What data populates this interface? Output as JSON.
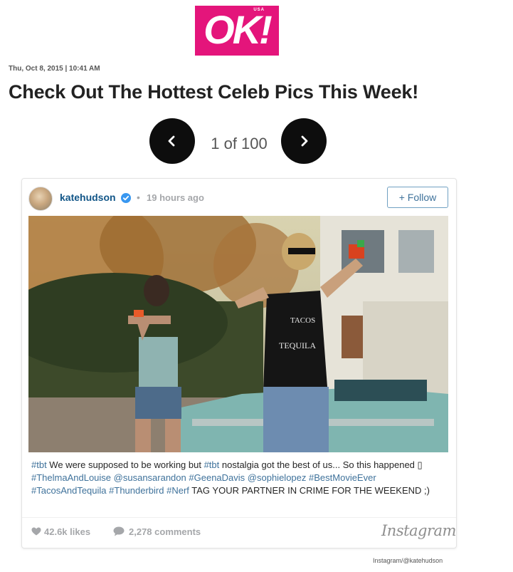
{
  "logo": {
    "text": "OK!",
    "edition": "USA"
  },
  "article": {
    "dateline": "Thu, Oct 8, 2015 | 10:41 AM",
    "title": "Check Out The Hottest Celeb Pics This Week!"
  },
  "gallery": {
    "counter": "1 of 100",
    "prev_icon": "chevron-left-icon",
    "next_icon": "chevron-right-icon"
  },
  "post": {
    "username": "katehudson",
    "time_ago": "19 hours ago",
    "follow_label": "+ Follow",
    "caption": [
      {
        "text": "#tbt",
        "tag": true
      },
      {
        "text": " We were supposed to be working but ",
        "tag": false
      },
      {
        "text": "#tbt",
        "tag": true
      },
      {
        "text": " nostalgia got the best of us... So this happened ",
        "tag": false
      },
      {
        "text": "▯",
        "tag": false
      },
      {
        "text": " ",
        "tag": false
      },
      {
        "text": "#ThelmaAndLouise",
        "tag": true
      },
      {
        "text": " ",
        "tag": false
      },
      {
        "text": "@susansarandon",
        "tag": true
      },
      {
        "text": " ",
        "tag": false
      },
      {
        "text": "#GeenaDavis",
        "tag": true
      },
      {
        "text": " ",
        "tag": false
      },
      {
        "text": "@sophielopez",
        "tag": true
      },
      {
        "text": " ",
        "tag": false
      },
      {
        "text": "#BestMovieEver",
        "tag": true
      },
      {
        "text": " ",
        "tag": false
      },
      {
        "text": "#TacosAndTequila",
        "tag": true
      },
      {
        "text": " ",
        "tag": false
      },
      {
        "text": "#Thunderbird",
        "tag": true
      },
      {
        "text": " ",
        "tag": false
      },
      {
        "text": "#Nerf",
        "tag": true
      },
      {
        "text": " TAG YOUR PARTNER IN CRIME FOR THE WEEKEND ;)",
        "tag": false
      }
    ],
    "likes": "42.6k likes",
    "comments": "2,278 comments",
    "platform": "Instagram",
    "shirt_text_1": "TACOS",
    "shirt_text_2": "TEQUILA"
  },
  "credit": "Instagram/@katehudson",
  "colors": {
    "brand_pink": "#e4157b",
    "link_blue": "#3f729b",
    "username_blue": "#125688",
    "muted_gray": "#a5a7aa"
  }
}
